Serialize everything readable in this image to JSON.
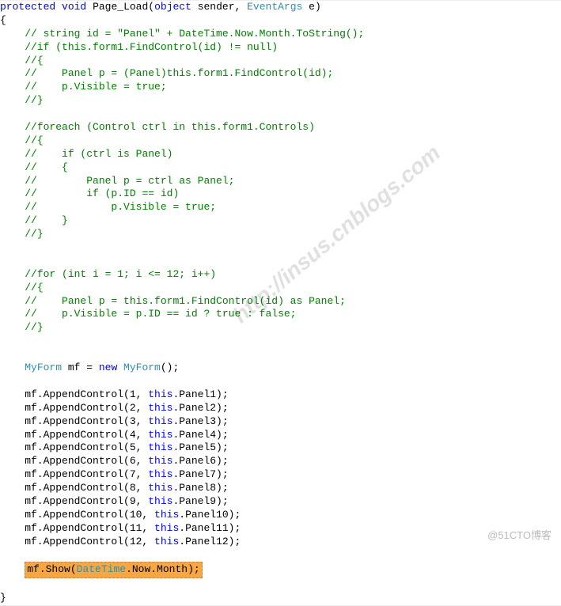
{
  "sig": {
    "protected": "protected",
    "void": "void",
    "name": "Page_Load",
    "object": "object",
    "sender": " sender, ",
    "eventargs": "EventArgs",
    "etail": " e)"
  },
  "brace_open": "{",
  "brace_close": "}",
  "c1": "// string id = \"Panel\" + DateTime.Now.Month.ToString();",
  "c2": "//if (this.form1.FindControl(id) != null)",
  "c3": "//{",
  "c4": "//    Panel p = (Panel)this.form1.FindControl(id);",
  "c5": "//    p.Visible = true;",
  "c6": "//}",
  "c7": "//foreach (Control ctrl in this.form1.Controls)",
  "c8": "//{",
  "c9": "//    if (ctrl is Panel)",
  "c10": "//    {",
  "c11": "//        Panel p = ctrl as Panel;",
  "c12": "//        if (p.ID == id)",
  "c13": "//            p.Visible = true;",
  "c14": "//    }",
  "c15": "//}",
  "c16": "//for (int i = 1; i <= 12; i++)",
  "c17": "//{",
  "c18": "//    Panel p = this.form1.FindControl(id) as Panel;",
  "c19": "//    p.Visible = p.ID == id ? true : false;",
  "c20": "//}",
  "decl": {
    "type": "MyForm",
    "var": " mf = ",
    "new": "new",
    "ctor": " MyForm",
    "tail": "();"
  },
  "append": {
    "prefix": "mf.AppendControl(",
    "this": "this",
    "lines": [
      {
        "n": "1",
        "p": ".Panel1);"
      },
      {
        "n": "2",
        "p": ".Panel2);"
      },
      {
        "n": "3",
        "p": ".Panel3);"
      },
      {
        "n": "4",
        "p": ".Panel4);"
      },
      {
        "n": "5",
        "p": ".Panel5);"
      },
      {
        "n": "6",
        "p": ".Panel6);"
      },
      {
        "n": "7",
        "p": ".Panel7);"
      },
      {
        "n": "8",
        "p": ".Panel8);"
      },
      {
        "n": "9",
        "p": ".Panel9);"
      },
      {
        "n": "10",
        "p": ".Panel10);"
      },
      {
        "n": "11",
        "p": ".Panel11);"
      },
      {
        "n": "12",
        "p": ".Panel12);"
      }
    ]
  },
  "show": {
    "pre": "mf.Show(",
    "dt": "DateTime",
    "now": ".Now.Month);"
  },
  "watermark": "http://insus.cnblogs.com",
  "credit": "@51CTO博客"
}
